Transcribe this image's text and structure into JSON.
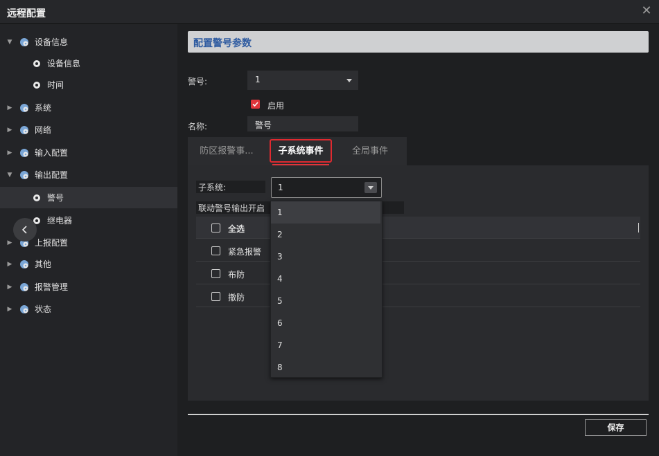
{
  "window": {
    "title": "远程配置",
    "close_glyph": "✕"
  },
  "sidebar": {
    "items": [
      {
        "label": "设备信息",
        "level": 0,
        "expanded": true,
        "icon": "gear-cluster-icon"
      },
      {
        "label": "设备信息",
        "level": 1,
        "icon": "gear-icon"
      },
      {
        "label": "时间",
        "level": 1,
        "icon": "gear-icon"
      },
      {
        "label": "系统",
        "level": 0,
        "expanded": false,
        "icon": "gear-cluster-icon"
      },
      {
        "label": "网络",
        "level": 0,
        "expanded": false,
        "icon": "gear-cluster-icon"
      },
      {
        "label": "输入配置",
        "level": 0,
        "expanded": false,
        "icon": "gear-cluster-icon"
      },
      {
        "label": "输出配置",
        "level": 0,
        "expanded": true,
        "icon": "gear-cluster-icon"
      },
      {
        "label": "警号",
        "level": 1,
        "selected": true,
        "icon": "gear-icon"
      },
      {
        "label": "继电器",
        "level": 1,
        "icon": "gear-icon"
      },
      {
        "label": "上报配置",
        "level": 0,
        "expanded": false,
        "icon": "gear-cluster-icon"
      },
      {
        "label": "其他",
        "level": 0,
        "expanded": false,
        "icon": "gear-cluster-icon"
      },
      {
        "label": "报警管理",
        "level": 0,
        "expanded": false,
        "icon": "gear-cluster-icon"
      },
      {
        "label": "状态",
        "level": 0,
        "expanded": false,
        "icon": "gear-cluster-icon"
      }
    ]
  },
  "main": {
    "section_title": "配置警号参数",
    "siren_label": "警号:",
    "siren_value": "1",
    "enable_label": "启用",
    "enable_checked": true,
    "name_label": "名称:",
    "name_value": "警号",
    "tabs": [
      {
        "label": "防区报警事..."
      },
      {
        "label": "子系统事件",
        "active": true
      },
      {
        "label": "全局事件"
      }
    ],
    "subsystem_label": "子系统:",
    "subsystem_value": "1",
    "linkage_label": "联动警号输出开启",
    "table_rows": [
      {
        "label": "全选",
        "header": true
      },
      {
        "label": "紧急报警"
      },
      {
        "label": "布防"
      },
      {
        "label": "撤防"
      }
    ],
    "dropdown_options": [
      "1",
      "2",
      "3",
      "4",
      "5",
      "6",
      "7",
      "8"
    ],
    "save_label": "保存"
  },
  "colors": {
    "accent": "#e0353b",
    "header_text": "#2d5aa0",
    "background": "#1e1f21"
  }
}
